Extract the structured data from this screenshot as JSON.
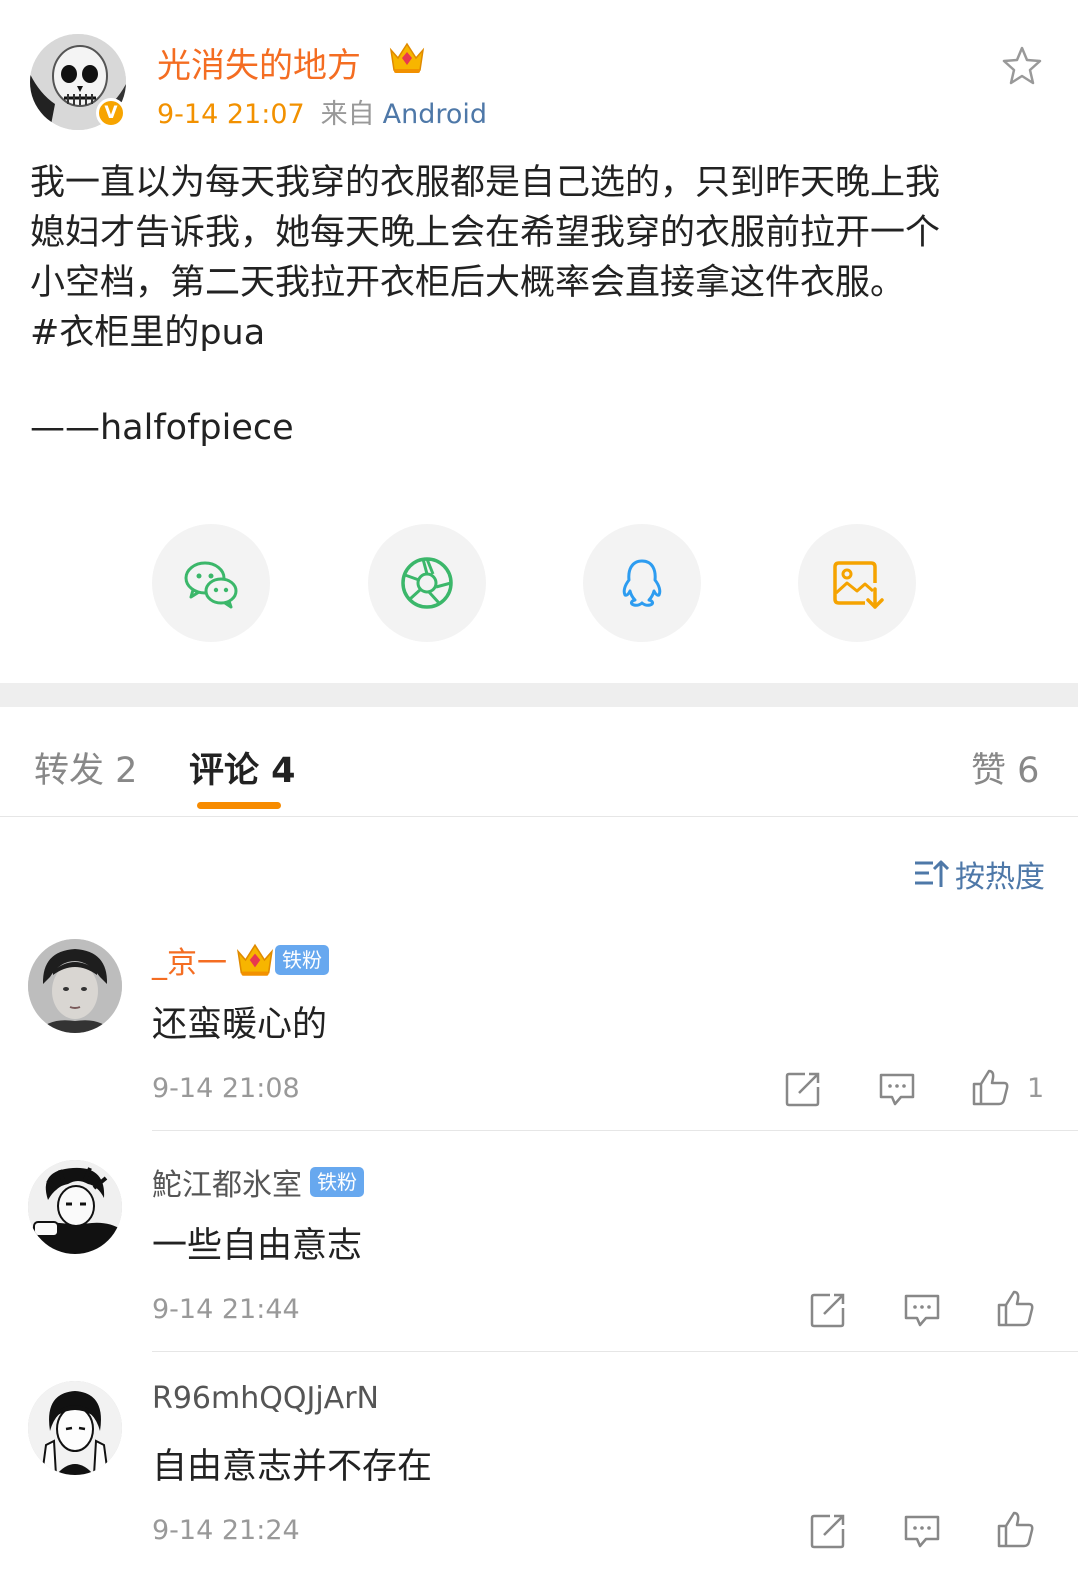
{
  "post": {
    "author": "光消失的地方",
    "verified_badge": "V",
    "time": "9-14 21:07",
    "source_prefix": "来自",
    "source": "Android",
    "text_lines": [
      "我一直以为每天我穿的衣服都是自己选的，只到昨天晚上我",
      "媳妇才告诉我，她每天晚上会在希望我穿的衣服前拉开一个",
      "小空档，第二天我拉开衣柜后大概率会直接拿这件衣服。",
      " #衣柜里的pua"
    ],
    "signature": "——halfofpiece"
  },
  "share_icons": [
    "wechat-icon",
    "moments-icon",
    "qq-icon",
    "save-image-icon"
  ],
  "tabs": {
    "repost": "转发 2",
    "comments": "评论 4",
    "likes": "赞 6"
  },
  "sort": {
    "label": "按热度"
  },
  "comments": [
    {
      "name": "_京一",
      "badge": "铁粉",
      "has_crown": true,
      "text": "还蛮暖心的",
      "time": "9-14 21:08",
      "likes": "1",
      "name_color": "#f46d22"
    },
    {
      "name": "鮀江都氷室",
      "badge": "铁粉",
      "has_crown": false,
      "text": "一些自由意志",
      "time": "9-14 21:44",
      "likes": "",
      "name_color": "#555555"
    },
    {
      "name": "R96mhQQJjArN",
      "badge": "",
      "has_crown": false,
      "text": "自由意志并不存在",
      "time": "9-14 21:24",
      "likes": "",
      "name_color": "#555555"
    }
  ],
  "colors": {
    "accent_orange": "#f78b00",
    "link_blue": "#4e78a8",
    "name_orange": "#f46d22"
  }
}
